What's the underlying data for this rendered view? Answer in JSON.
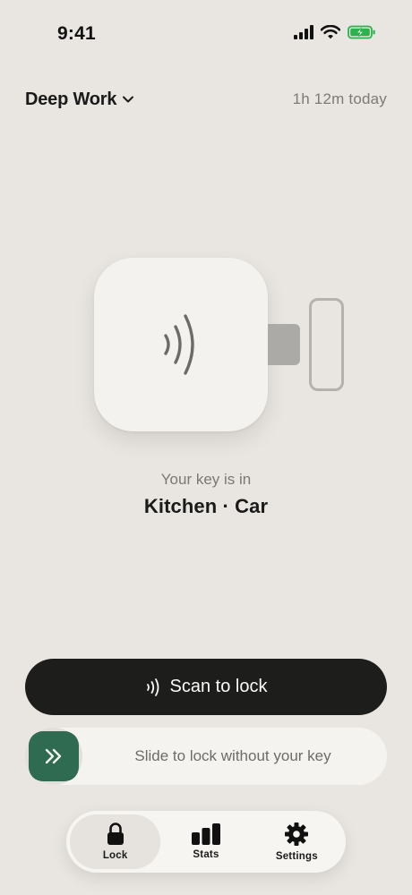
{
  "status_bar": {
    "time": "9:41"
  },
  "header": {
    "mode_title": "Deep Work",
    "time_today": "1h 12m today"
  },
  "key_status": {
    "label": "Your key is in",
    "location": "Kitchen · Car"
  },
  "actions": {
    "scan_label": "Scan to lock",
    "slide_label": "Slide to lock without your key"
  },
  "tabs": [
    {
      "label": "Lock",
      "icon": "lock-icon",
      "active": true
    },
    {
      "label": "Stats",
      "icon": "stats-icon",
      "active": false
    },
    {
      "label": "Settings",
      "icon": "gear-icon",
      "active": false
    }
  ],
  "colors": {
    "background": "#e9e6e1",
    "primary_button": "#1d1d1b",
    "slide_handle": "#2e6b50",
    "battery": "#2bb24c"
  }
}
